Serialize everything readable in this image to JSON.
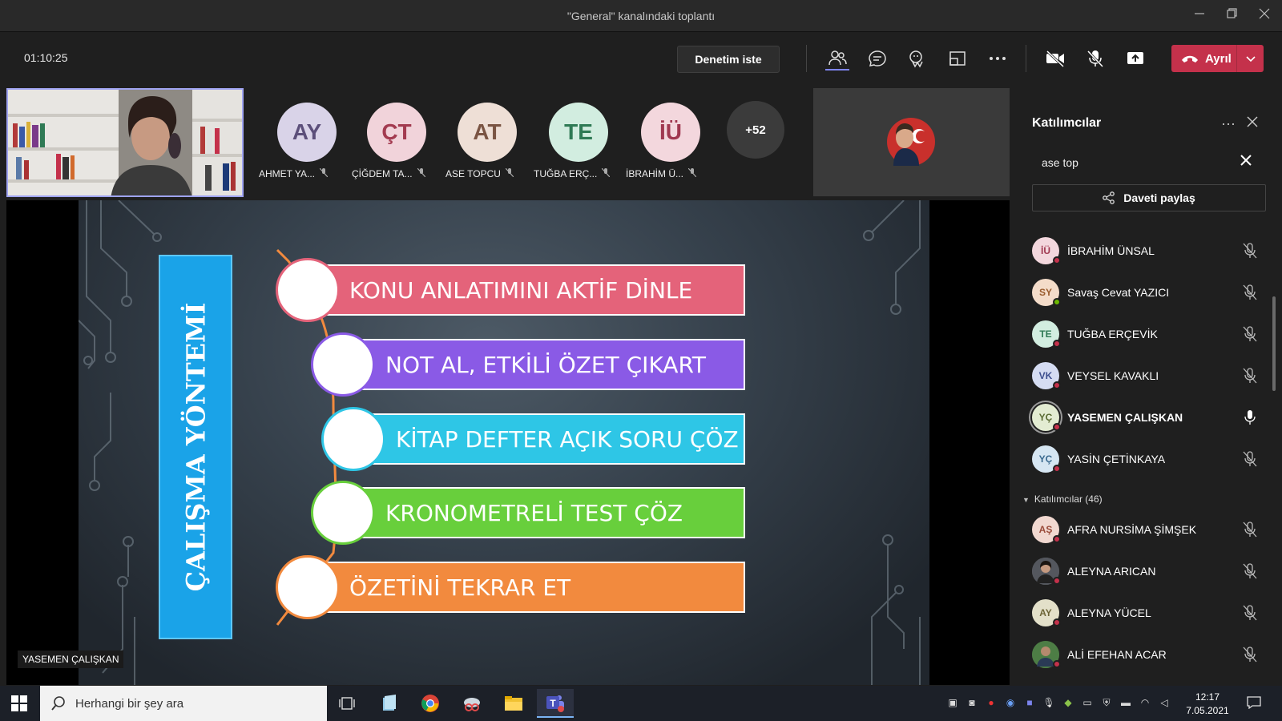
{
  "window": {
    "title": "\"General\" kanalındaki toplantı"
  },
  "toolbar": {
    "timer": "01:10:25",
    "request_control": "Denetim iste",
    "leave_label": "Ayrıl",
    "icons": [
      "people-icon",
      "chat-icon",
      "reactions-icon",
      "view-icon",
      "more-icon",
      "camera-off-icon",
      "mic-off-icon",
      "share-icon"
    ]
  },
  "gallery": {
    "participants": [
      {
        "initials": "AY",
        "name": "AHMET YA...",
        "color": "#d9d3e8",
        "text_color": "#5c4f7a"
      },
      {
        "initials": "ÇT",
        "name": "ÇİĞDEM TA...",
        "color": "#f1d3da",
        "text_color": "#a33b50"
      },
      {
        "initials": "AT",
        "name": "ASE TOPCU",
        "color": "#eedfd6",
        "text_color": "#7a5443"
      },
      {
        "initials": "TE",
        "name": "TUĞBA ERÇ...",
        "color": "#d2ede0",
        "text_color": "#2f7a55"
      },
      {
        "initials": "İÜ",
        "name": "İBRAHİM Ü...",
        "color": "#f3d7dd",
        "text_color": "#a03850"
      }
    ],
    "more_count": "+52"
  },
  "slide": {
    "title": "ÇALIŞMA YÖNTEMİ",
    "steps": [
      {
        "text": "KONU ANLATIMINI AKTİF DİNLE",
        "color": "#e4637a"
      },
      {
        "text": "NOT AL, ETKİLİ ÖZET ÇIKART",
        "color": "#8a5ae6"
      },
      {
        "text": "KİTAP DEFTER AÇIK SORU ÇÖZ",
        "color": "#2ec6e6"
      },
      {
        "text": "KRONOMETRELİ TEST ÇÖZ",
        "color": "#68cf3c"
      },
      {
        "text": "ÖZETİNİ TEKRAR ET",
        "color": "#f28a3e"
      }
    ]
  },
  "stage": {
    "speaker_name": "YASEMEN ÇALIŞKAN"
  },
  "panel": {
    "title": "Katılımcılar",
    "search_value": "ase top",
    "invite_label": "Daveti paylaş",
    "section_label": "Katılımcılar (46)",
    "top_list": [
      {
        "initials": "İÜ",
        "name": "İBRAHİM ÜNSAL",
        "bg": "#f3d7dd",
        "fg": "#a03850",
        "status": "#c4314b",
        "mic": "off"
      },
      {
        "initials": "SY",
        "name": "Savaş Cevat YAZICI",
        "bg": "#f4dcc9",
        "fg": "#9a5b2c",
        "status": "#6bb700",
        "mic": "off"
      },
      {
        "initials": "TE",
        "name": "TUĞBA ERÇEVİK",
        "bg": "#d2ede0",
        "fg": "#2f7a55",
        "status": "#c4314b",
        "mic": "off"
      },
      {
        "initials": "VK",
        "name": "VEYSEL KAVAKLI",
        "bg": "#d5dcf2",
        "fg": "#3e4f8f",
        "status": "#c4314b",
        "mic": "off"
      },
      {
        "initials": "YÇ",
        "name": "YASEMEN ÇALIŞKAN",
        "bg": "#e3ecd2",
        "fg": "#5a6b33",
        "status": "#c4314b",
        "mic": "on"
      },
      {
        "initials": "YÇ",
        "name": "YASİN ÇETİNKAYA",
        "bg": "#d6e6f2",
        "fg": "#3a6a8f",
        "status": "#c4314b",
        "mic": "off"
      }
    ],
    "bottom_list": [
      {
        "initials": "AŞ",
        "name": "AFRA NURSİMA ŞİMŞEK",
        "bg": "#f1d8d0",
        "fg": "#9a4b3a",
        "status": "#c4314b",
        "mic": "off"
      },
      {
        "initials": "",
        "name": "ALEYNA ARICAN",
        "bg": "#6d6a6f",
        "fg": "#fff",
        "status": "#c4314b",
        "mic": "off"
      },
      {
        "initials": "AY",
        "name": "ALEYNA YÜCEL",
        "bg": "#e3e0c9",
        "fg": "#6d6536",
        "status": "#c4314b",
        "mic": "off"
      },
      {
        "initials": "",
        "name": "ALİ EFEHAN ACAR",
        "bg": "#3f6a3a",
        "fg": "#fff",
        "status": "#c4314b",
        "mic": "off"
      }
    ]
  },
  "taskbar": {
    "search_placeholder": "Herhangi bir şey ara",
    "time": "12:17",
    "date": "7.05.2021"
  }
}
